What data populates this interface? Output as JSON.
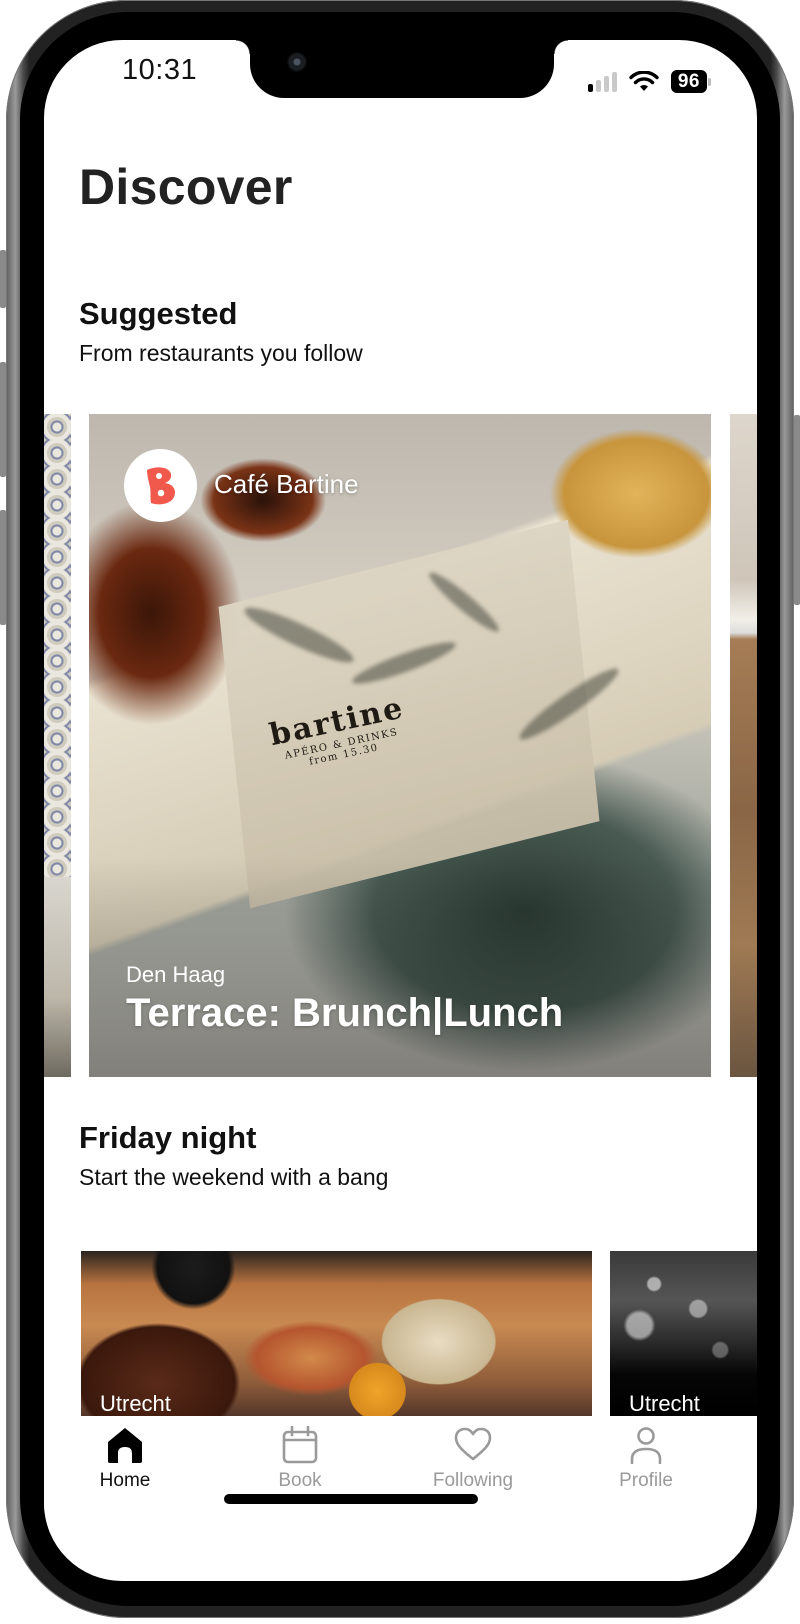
{
  "status_bar": {
    "time": "10:31",
    "signal_bars_on": 1,
    "signal_bars_total": 4,
    "battery_percent": "96",
    "icons": [
      "cellular-signal-icon",
      "wifi-icon",
      "battery-icon"
    ]
  },
  "page": {
    "title": "Discover"
  },
  "sections": [
    {
      "title": "Suggested",
      "subtitle": "From restaurants you follow",
      "cards": [
        {
          "restaurant": "Café Bartine",
          "logo_letter": "B",
          "logo_color": "#F0594C",
          "city": "Den Haag",
          "headline": "Terrace: Brunch|Lunch",
          "photo_text": {
            "brand": "bartine",
            "line1": "APÉRO & DRINKS",
            "line2": "from 15.30"
          }
        }
      ]
    },
    {
      "title": "Friday night",
      "subtitle": "Start the weekend with a bang",
      "cards": [
        {
          "city": "Utrecht"
        },
        {
          "city": "Utrecht"
        }
      ]
    }
  ],
  "tabbar": {
    "items": [
      {
        "label": "Home",
        "icon": "home-icon",
        "active": true
      },
      {
        "label": "Book",
        "icon": "calendar-icon",
        "active": false
      },
      {
        "label": "Following",
        "icon": "heart-icon",
        "active": false
      },
      {
        "label": "Profile",
        "icon": "person-icon",
        "active": false
      }
    ],
    "active_color": "#111111",
    "inactive_color": "#9A9A9A"
  }
}
